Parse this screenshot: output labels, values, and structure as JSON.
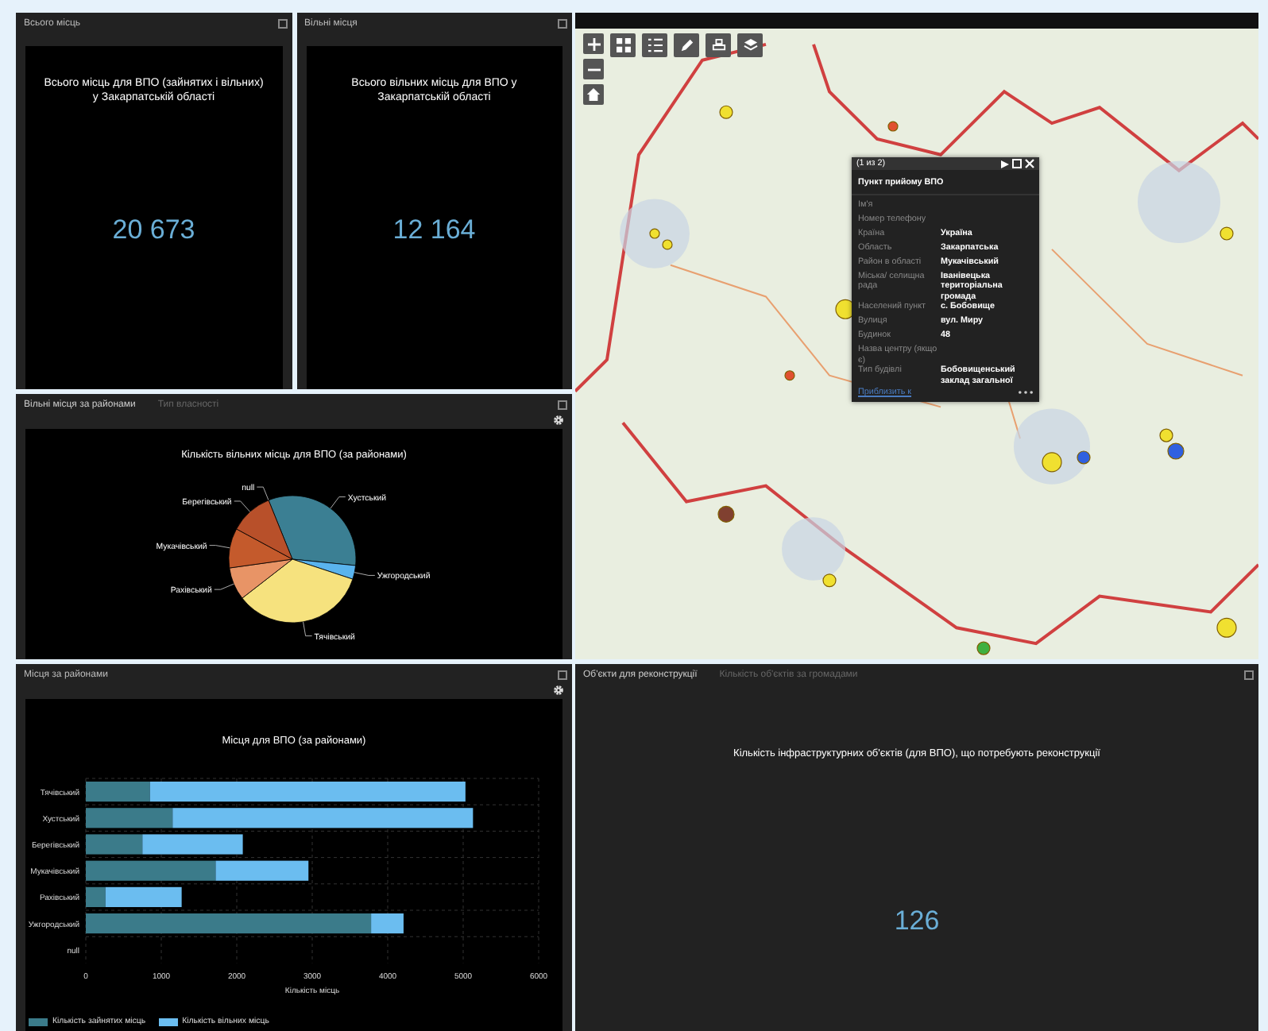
{
  "indicators": [
    {
      "title": "Всього місць",
      "heading": "Всього місць для ВПО (зайнятих і вільних) у Закарпатській області",
      "value": "20 673"
    },
    {
      "title": "Вільні місця",
      "heading": "Всього вільних місць для ВПО у Закарпатській області",
      "value": "12 164"
    }
  ],
  "pie_panel": {
    "tabs": [
      {
        "label": "Вільні місця за районами",
        "selected": true
      },
      {
        "label": "Тип власності",
        "selected": false
      }
    ],
    "chart_data": {
      "type": "pie",
      "title": "Кількість вільних місць для ВПО (за районами)",
      "categories": [
        "null",
        "Хустський",
        "Ужгородський",
        "Тячівський",
        "Рахівський",
        "Мукачівський",
        "Берегівський"
      ],
      "series": [
        {
          "colors": [
            "#3a8aa8",
            "#3b7f93",
            "#5ab4ee",
            "#f6e27e",
            "#e89466",
            "#c45a2c",
            "#b8502a"
          ],
          "values": [
            0,
            32.7,
            3.5,
            34.4,
            8.3,
            10.1,
            11.0
          ]
        }
      ]
    }
  },
  "bar_panel": {
    "title": "Місця за районами",
    "chart_data": {
      "type": "bar",
      "orientation": "horizontal",
      "stacked": true,
      "title": "Місця для ВПО (за районами)",
      "xlabel": "Кількість місць",
      "categories": [
        "Тячівський",
        "Хустський",
        "Берегівський",
        "Мукачівський",
        "Рахівський",
        "Ужгородський",
        "null"
      ],
      "series": [
        {
          "name": "Кількість зайнятих місць",
          "color": "#3b7b8a",
          "values": [
            850,
            1150,
            750,
            1720,
            260,
            3780,
            null
          ]
        },
        {
          "name": "Кількість вільних місць",
          "color": "#6bbdf0",
          "values": [
            4180,
            3980,
            1330,
            1230,
            1010,
            430,
            null
          ]
        }
      ],
      "grid": true,
      "legend": "bottom",
      "xlim": [
        0,
        6000
      ],
      "xticks": [
        0,
        1000,
        2000,
        3000,
        4000,
        5000,
        6000
      ]
    }
  },
  "map": {
    "popup": {
      "counter": "(1 из 2)",
      "title": "Пункт прийому ВПО",
      "fields": [
        {
          "label": "Ім'я"
        },
        {
          "label": "Номер телефону"
        },
        {
          "label": "Країна",
          "value": "Україна"
        },
        {
          "label": "Область",
          "value": "Закарпатська"
        },
        {
          "label": "Район в області",
          "value": "Мукачівський"
        },
        {
          "label": "Міська/ селищна рада",
          "value": "Іванівецька територіальна громада"
        },
        {
          "label": "Населений пункт",
          "value": "с. Бобовище"
        },
        {
          "label": "Вулиця",
          "value": "вул. Миру"
        },
        {
          "label": "Будинок",
          "value": "48"
        },
        {
          "label": "Назва центру (якщо є)"
        },
        {
          "label": "Тип будівлі",
          "value": "Бобовищенський заклад загальної"
        }
      ],
      "link": "Приблизить к"
    }
  },
  "reconstruction_panel": {
    "tabs": [
      {
        "label": "Об'єкти для реконструкції",
        "selected": true
      },
      {
        "label": "Кількість об'єктів за громадами",
        "selected": false
      }
    ],
    "heading": "Кількість інфраструктурних об'єктів (для ВПО), що потребують реконструкції",
    "value": "126"
  }
}
